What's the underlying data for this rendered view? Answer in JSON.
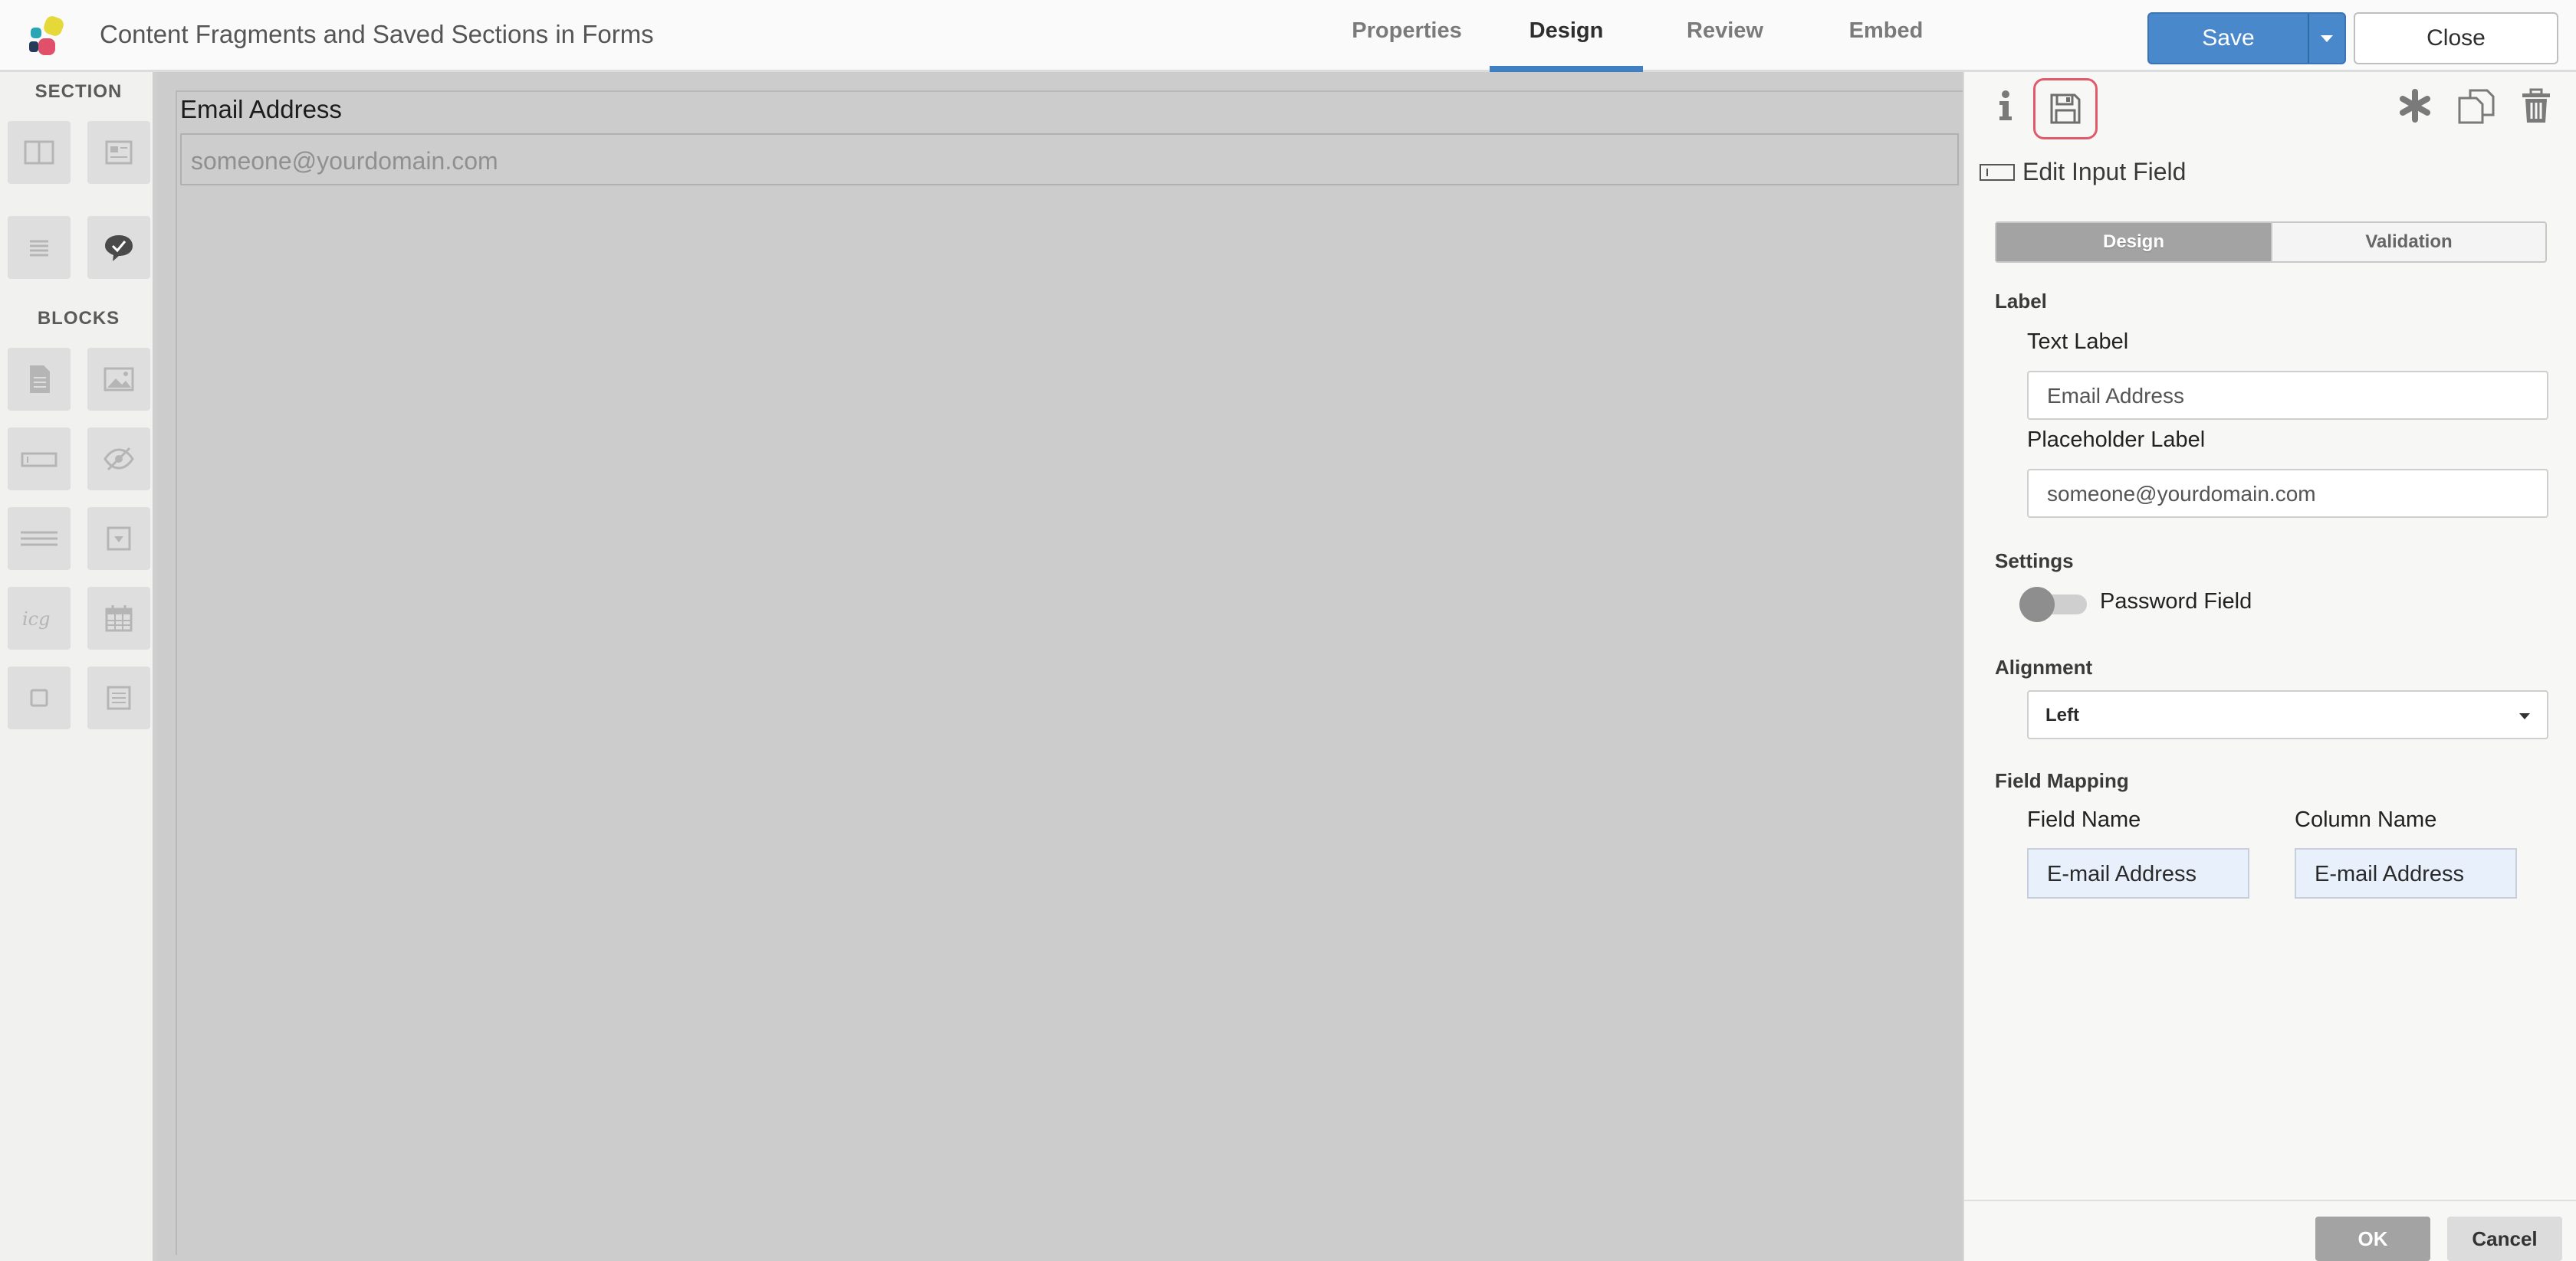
{
  "app": {
    "title": "Content Fragments and Saved Sections in Forms",
    "tabs": [
      "Properties",
      "Design",
      "Review",
      "Embed"
    ],
    "active_tab": "Design",
    "save_label": "Save",
    "close_label": "Close"
  },
  "palette": {
    "section_heading": "SECTION",
    "blocks_heading": "BLOCKS",
    "section_items": [
      "columns-layout-icon",
      "header-layout-icon",
      "text-lines-icon",
      "comment-check-icon"
    ],
    "block_items": [
      "document-icon",
      "image-icon",
      "input-field-icon",
      "hidden-field-icon",
      "textarea-icon",
      "dropdown-icon",
      "captcha-icon",
      "calendar-icon",
      "checkbox-icon",
      "form-icon"
    ]
  },
  "canvas": {
    "field_label": "Email Address",
    "field_placeholder": "someone@yourdomain.com"
  },
  "panel": {
    "heading": "Edit Input Field",
    "tabs": {
      "design": "Design",
      "validation": "Validation"
    },
    "label_section": "Label",
    "text_label_caption": "Text Label",
    "text_label_value": "Email Address",
    "placeholder_caption": "Placeholder Label",
    "placeholder_value": "someone@yourdomain.com",
    "settings_section": "Settings",
    "password_toggle_label": "Password Field",
    "password_toggle_on": false,
    "alignment_section": "Alignment",
    "alignment_value": "Left",
    "mapping_section": "Field Mapping",
    "field_name_caption": "Field Name",
    "column_name_caption": "Column Name",
    "field_name_value": "E-mail Address",
    "column_name_value": "E-mail Address",
    "ok_label": "OK",
    "cancel_label": "Cancel"
  },
  "colors": {
    "accent": "#4a88cc",
    "highlight": "#e05a6a",
    "canvas_bg": "#cccccc"
  }
}
